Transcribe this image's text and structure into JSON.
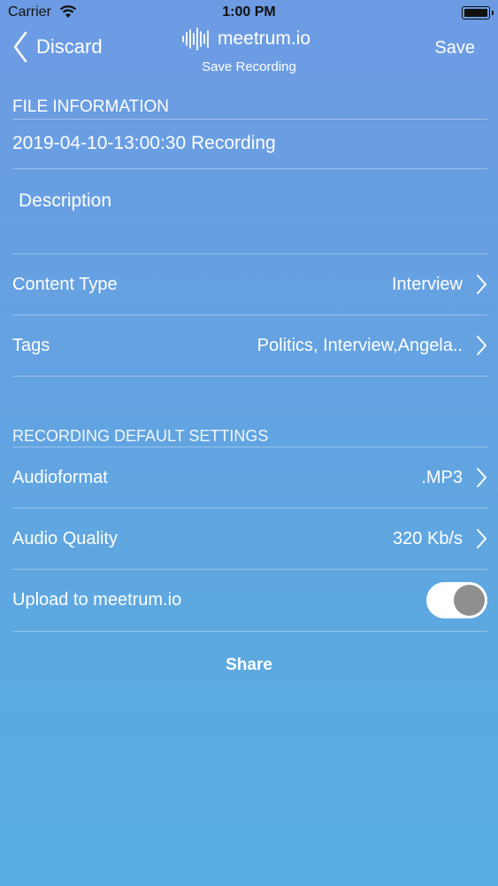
{
  "status_bar": {
    "carrier": "Carrier",
    "time": "1:00 PM"
  },
  "nav": {
    "back_label": "Discard",
    "brand_name": "meetrum.io",
    "subtitle": "Save Recording",
    "save_label": "Save"
  },
  "file_info": {
    "header": "FILE INFORMATION",
    "filename": "2019-04-10-13:00:30 Recording",
    "description_placeholder": "Description",
    "content_type": {
      "label": "Content Type",
      "value": "Interview"
    },
    "tags": {
      "label": "Tags",
      "value": "Politics, Interview,Angela.."
    }
  },
  "recording_defaults": {
    "header": "RECORDING DEFAULT SETTINGS",
    "audioformat": {
      "label": "Audioformat",
      "value": ".MP3"
    },
    "audio_quality": {
      "label": "Audio Quality",
      "value": "320 Kb/s"
    },
    "upload": {
      "label": "Upload to meetrum.io",
      "enabled": true
    }
  },
  "share_label": "Share",
  "colors": {
    "gradient_top": "#6d9be3",
    "gradient_bottom": "#56aee0",
    "text": "#ffffff",
    "toggle_knob": "#8e8e8e"
  },
  "icons": [
    "wifi-icon",
    "battery-icon",
    "back-chevron-icon",
    "waveform-logo-icon",
    "chevron-right-icon"
  ]
}
